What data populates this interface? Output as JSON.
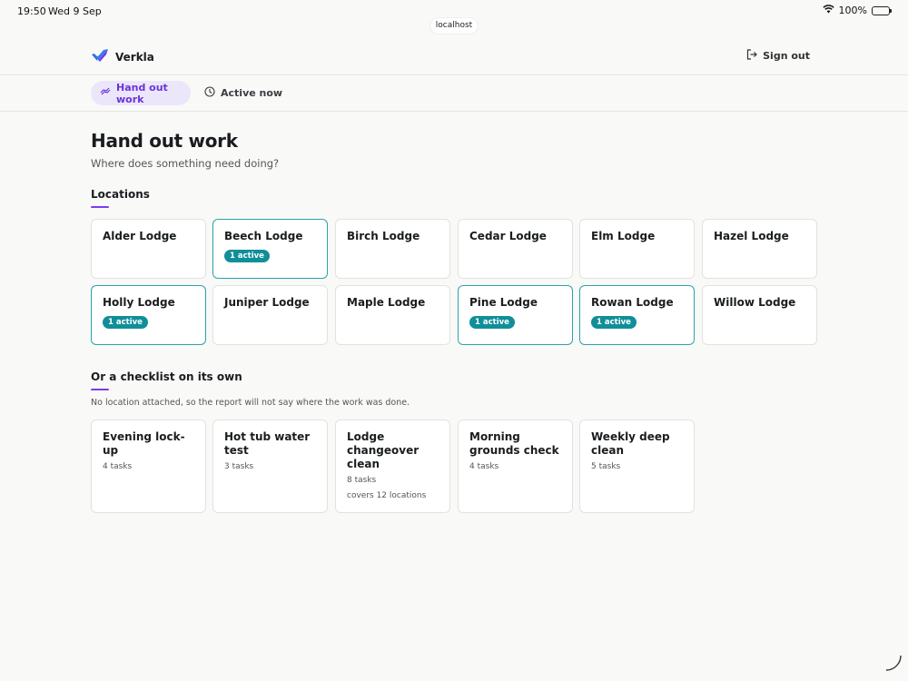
{
  "status": {
    "time": "19:50",
    "date": "Wed 9 Sep",
    "battery": "100%"
  },
  "browser": {
    "url": "localhost"
  },
  "header": {
    "brand": "Verkla",
    "signout_label": "Sign out"
  },
  "nav": {
    "tab_hand_out": "Hand out work",
    "tab_active": "Active now"
  },
  "main": {
    "title": "Hand out work",
    "subtitle": "Where does something need doing?",
    "locations_title": "Locations",
    "locations": [
      {
        "name": "Alder Lodge",
        "badge": ""
      },
      {
        "name": "Beech Lodge",
        "badge": "1 active"
      },
      {
        "name": "Birch Lodge",
        "badge": ""
      },
      {
        "name": "Cedar Lodge",
        "badge": ""
      },
      {
        "name": "Elm Lodge",
        "badge": ""
      },
      {
        "name": "Hazel Lodge",
        "badge": ""
      },
      {
        "name": "Holly Lodge",
        "badge": "1 active"
      },
      {
        "name": "Juniper Lodge",
        "badge": ""
      },
      {
        "name": "Maple Lodge",
        "badge": ""
      },
      {
        "name": "Pine Lodge",
        "badge": "1 active"
      },
      {
        "name": "Rowan Lodge",
        "badge": "1 active"
      },
      {
        "name": "Willow Lodge",
        "badge": ""
      }
    ],
    "checklist_title": "Or a checklist on its own",
    "checklist_note": "No location attached, so the report will not say where the work was done.",
    "checklists": [
      {
        "name": "Evening lock-up",
        "tasks": "4 tasks",
        "extra": ""
      },
      {
        "name": "Hot tub water test",
        "tasks": "3 tasks",
        "extra": ""
      },
      {
        "name": "Lodge changeover clean",
        "tasks": "8 tasks",
        "extra": "covers 12 locations"
      },
      {
        "name": "Morning grounds check",
        "tasks": "4 tasks",
        "extra": ""
      },
      {
        "name": "Weekly deep clean",
        "tasks": "5 tasks",
        "extra": ""
      }
    ]
  },
  "colors": {
    "accent": "#6a35d6",
    "active_badge": "#118f98",
    "active_border": "#2aa3a8"
  }
}
